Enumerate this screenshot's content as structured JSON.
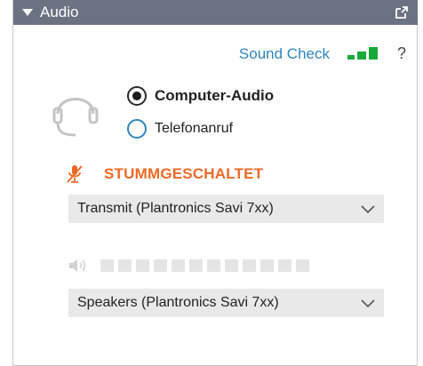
{
  "panel": {
    "title": "Audio"
  },
  "sound_check": {
    "label": "Sound Check",
    "help": "?"
  },
  "audio_options": {
    "computer_audio": "Computer-Audio",
    "phone_call": "Telefonanruf",
    "selected": "Computer-Audio"
  },
  "mute": {
    "label": "STUMMGESCHALTET",
    "color": "#ef6a27"
  },
  "microphone_select": {
    "value": "Transmit (Plantronics Savi 7xx)"
  },
  "speaker_volume": {
    "level": 0,
    "segments": 12
  },
  "speaker_select": {
    "value": "Speakers (Plantronics Savi 7xx)"
  },
  "colors": {
    "titlebar": "#6b7383",
    "link": "#2f86c4",
    "meter_green": "#1aa83a",
    "dropdown_bg": "#e9e9e9"
  }
}
